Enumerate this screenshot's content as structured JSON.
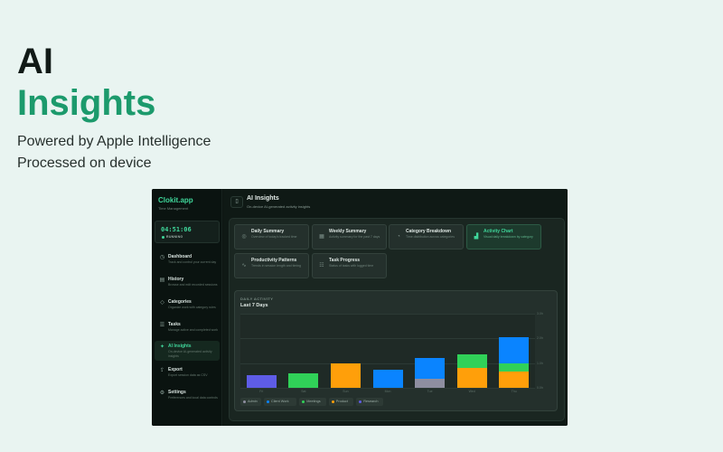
{
  "hero": {
    "title_line1": "AI",
    "title_line2": "Insights",
    "subtitle_line1": "Powered by Apple Intelligence",
    "subtitle_line2": "Processed on device"
  },
  "app": {
    "brand": "Clokit.app",
    "brand_sub": "Time Management",
    "timer": {
      "value": "04:51:06",
      "status": "RUNNING"
    }
  },
  "sidebar": {
    "items": [
      {
        "label": "Dashboard",
        "desc": "Track and control your current day",
        "icon": "clock-icon"
      },
      {
        "label": "History",
        "desc": "Browse and edit recorded sessions",
        "icon": "history-icon"
      },
      {
        "label": "Categories",
        "desc": "Organize work with category rules",
        "icon": "tag-icon"
      },
      {
        "label": "Tasks",
        "desc": "Manage active and completed work",
        "icon": "list-icon"
      },
      {
        "label": "AI Insights",
        "desc": "On-device AI-generated activity insights",
        "icon": "sparkle-icon"
      },
      {
        "label": "Export",
        "desc": "Export session data as CSV",
        "icon": "export-icon"
      },
      {
        "label": "Settings",
        "desc": "Preferences and local data controls",
        "icon": "gear-icon"
      }
    ]
  },
  "header": {
    "title": "AI Insights",
    "subtitle": "On-device AI-generated activity insights"
  },
  "insight_cards": [
    {
      "title": "Daily Summary",
      "desc": "Overview of today's tracked time",
      "icon": "target-icon"
    },
    {
      "title": "Weekly Summary",
      "desc": "Activity summary for the past 7 days",
      "icon": "calendar-icon"
    },
    {
      "title": "Category Breakdown",
      "desc": "Time distribution across categories",
      "icon": "pie-icon"
    },
    {
      "title": "Activity Chart",
      "desc": "Visual daily breakdown by category",
      "icon": "bar-chart-icon"
    },
    {
      "title": "Productivity Patterns",
      "desc": "Trends in session length and timing",
      "icon": "pulse-icon"
    },
    {
      "title": "Task Progress",
      "desc": "Status of tasks with logged time",
      "icon": "checklist-icon"
    }
  ],
  "chart_data": {
    "type": "bar",
    "heading": "DAILY ACTIVITY",
    "title": "Last 7 Days",
    "categories": [
      "Fri",
      "Sat",
      "Sun",
      "Mon",
      "Tue",
      "Wed",
      "Thu"
    ],
    "yticks": [
      "0.0h",
      "1.0h",
      "2.0h",
      "3.0h"
    ],
    "ylim": [
      0,
      3
    ],
    "stacked": true,
    "series": [
      {
        "name": "Admin",
        "color": "#8e8ea0",
        "values": [
          0,
          0,
          0,
          0,
          0.35,
          0,
          0
        ]
      },
      {
        "name": "Client Work",
        "color": "#0a84ff",
        "values": [
          0,
          0,
          0,
          0.75,
          0.85,
          0,
          1.05
        ]
      },
      {
        "name": "Meetings",
        "color": "#30d158",
        "values": [
          0,
          0.6,
          0,
          0,
          0,
          0.55,
          0.35
        ]
      },
      {
        "name": "Product",
        "color": "#ff9f0a",
        "values": [
          0,
          0,
          1.0,
          0,
          0,
          0.8,
          0.65
        ]
      },
      {
        "name": "Research",
        "color": "#5e5ce6",
        "values": [
          0.5,
          0,
          0,
          0,
          0,
          0,
          0
        ]
      }
    ],
    "legend_position": "bottom-left",
    "grid": true
  }
}
